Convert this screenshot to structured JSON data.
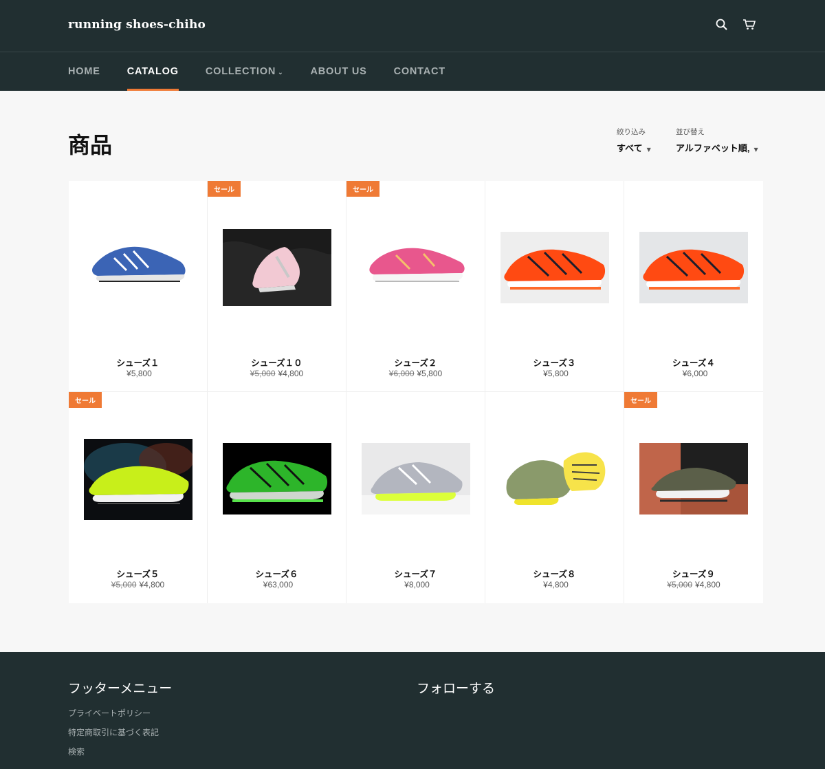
{
  "header": {
    "site_title": "running shoes-chiho",
    "icons": [
      "search-icon",
      "cart-icon"
    ]
  },
  "nav": {
    "items": [
      {
        "label": "HOME",
        "active": false
      },
      {
        "label": "CATALOG",
        "active": true
      },
      {
        "label": "COLLECTION",
        "active": false,
        "has_dropdown": true
      },
      {
        "label": "ABOUT US",
        "active": false
      },
      {
        "label": "CONTACT",
        "active": false
      }
    ]
  },
  "collection": {
    "title": "商品",
    "filter_label": "絞り込み",
    "filter_value": "すべて",
    "sort_label": "並び替え",
    "sort_value": "アルファベット順,"
  },
  "products": [
    {
      "name": "シューズ１",
      "price": "¥5,800",
      "compare_price": "",
      "sale": false
    },
    {
      "name": "シューズ１０",
      "price": "¥4,800",
      "compare_price": "¥5,000",
      "sale": true
    },
    {
      "name": "シューズ２",
      "price": "¥5,800",
      "compare_price": "¥6,000",
      "sale": true
    },
    {
      "name": "シューズ３",
      "price": "¥5,800",
      "compare_price": "",
      "sale": false
    },
    {
      "name": "シューズ４",
      "price": "¥6,000",
      "compare_price": "",
      "sale": false
    },
    {
      "name": "シューズ５",
      "price": "¥4,800",
      "compare_price": "¥5,000",
      "sale": true
    },
    {
      "name": "シューズ６",
      "price": "¥63,000",
      "compare_price": "",
      "sale": false
    },
    {
      "name": "シューズ７",
      "price": "¥8,000",
      "compare_price": "",
      "sale": false
    },
    {
      "name": "シューズ８",
      "price": "¥4,800",
      "compare_price": "",
      "sale": false
    },
    {
      "name": "シューズ９",
      "price": "¥4,800",
      "compare_price": "¥5,000",
      "sale": true
    }
  ],
  "sale_badge": "セール",
  "footer": {
    "menu_heading": "フッターメニュー",
    "follow_heading": "フォローする",
    "links": [
      "プライベートポリシー",
      "特定商取引に基づく表記",
      "検索"
    ]
  },
  "colors": {
    "header_bg": "#212f31",
    "accent": "#ef7a35",
    "page_bg": "#f7f7f7"
  }
}
